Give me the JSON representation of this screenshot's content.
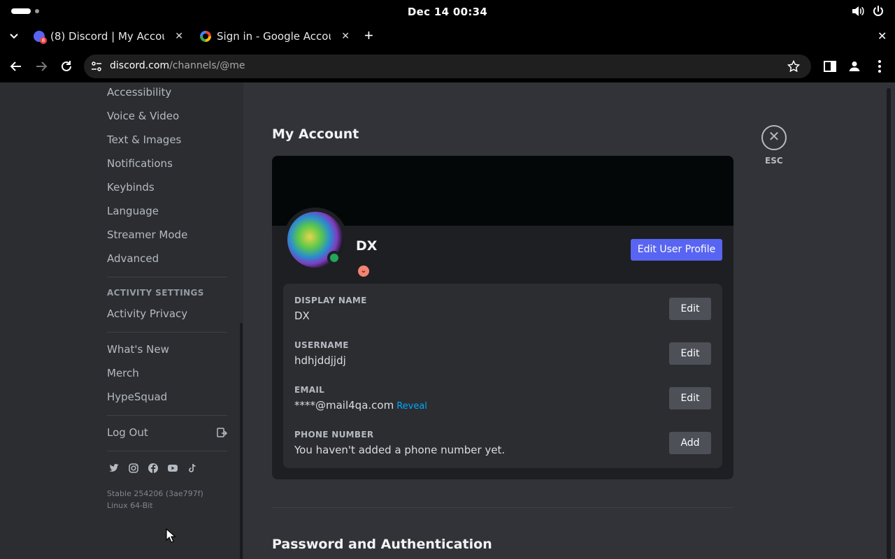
{
  "os": {
    "clock": "Dec 14  00:34",
    "icons": [
      "volume-icon",
      "power-icon"
    ]
  },
  "browser": {
    "tabs": [
      {
        "title": "(8) Discord | My Account",
        "favicon": "discord-icon",
        "badge": "8",
        "active": true
      },
      {
        "title": "Sign in - Google Account",
        "favicon": "google-icon",
        "active": false
      }
    ],
    "new_tab": "+",
    "url_host": "discord.com",
    "url_path": "/channels/@me"
  },
  "sidebar": {
    "items_top": [
      "Accessibility",
      "Voice & Video",
      "Text & Images",
      "Notifications",
      "Keybinds",
      "Language",
      "Streamer Mode",
      "Advanced"
    ],
    "activity_header": "ACTIVITY SETTINGS",
    "activity_items": [
      "Activity Privacy"
    ],
    "misc_items": [
      "What's New",
      "Merch",
      "HypeSquad"
    ],
    "logout": "Log Out",
    "socials": [
      "twitter-icon",
      "instagram-icon",
      "facebook-icon",
      "youtube-icon",
      "tiktok-icon"
    ],
    "version_line1": "Stable 254206 (3ae797f)",
    "version_line2": "Linux 64-Bit"
  },
  "main": {
    "title": "My Account",
    "esc_label": "ESC",
    "profile": {
      "display": "DX",
      "edit_profile_label": "Edit User Profile"
    },
    "fields": [
      {
        "label": "DISPLAY NAME",
        "value": "DX",
        "button": "Edit"
      },
      {
        "label": "USERNAME",
        "value": "hdhjddjjdj",
        "button": "Edit"
      },
      {
        "label": "EMAIL",
        "value": "****@mail4qa.com",
        "extra": "Reveal",
        "button": "Edit"
      },
      {
        "label": "PHONE NUMBER",
        "value": "You haven't added a phone number yet.",
        "button": "Add"
      }
    ],
    "next_section": "Password and Authentication"
  },
  "colors": {
    "accent": "#5865f2",
    "online": "#23a55a",
    "link": "#00a8fc"
  }
}
